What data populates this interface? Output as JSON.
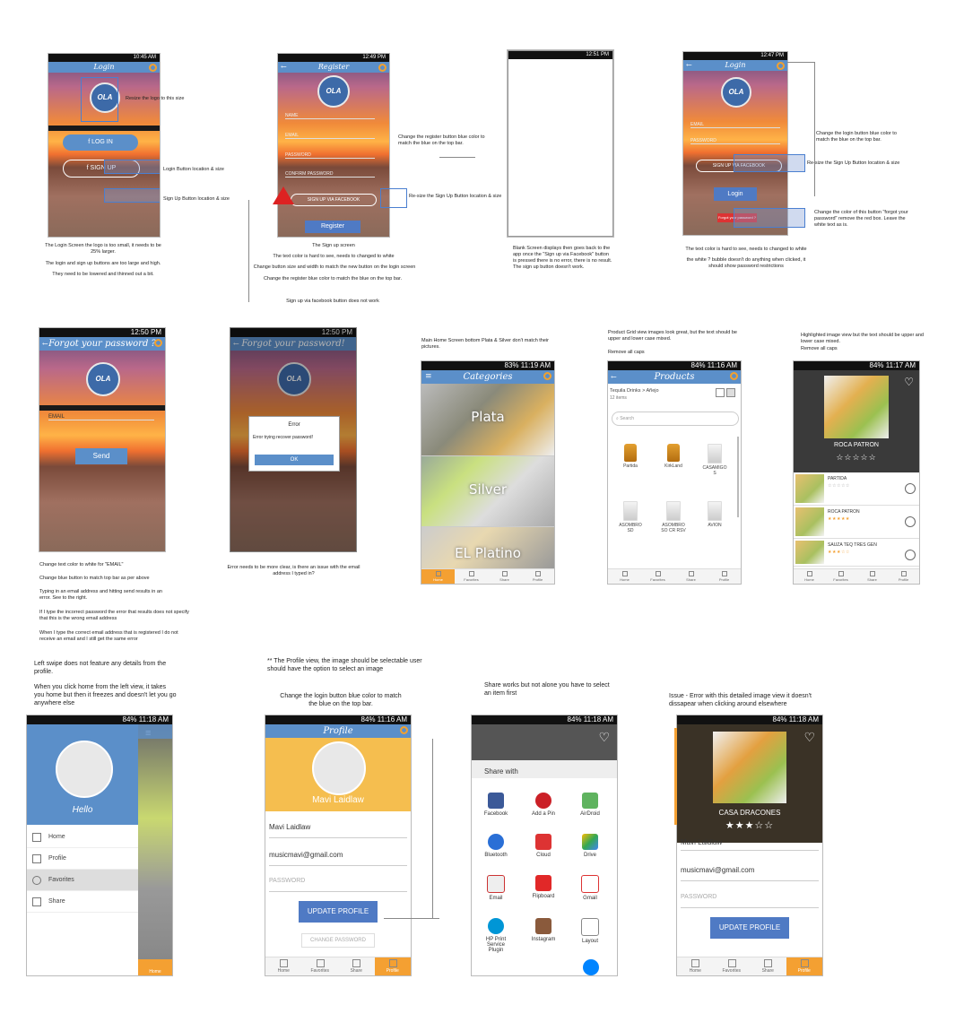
{
  "screens": {
    "login": {
      "status_time": "10:45 AM",
      "title": "Login",
      "logo_text": "OLA",
      "login_button": "LOG IN",
      "signup_button": "SIGN UP",
      "notes": {
        "logo": "Resize the logo to this size",
        "login_loc": "Login Button location & size",
        "signup_loc": "Sign Up Button location & size",
        "bottom": [
          "The Login Screen the logo is too small, it needs to be 25% larger.",
          "The login and sign up buttons are too large and high.",
          "They need to be lowered and thinned out a bit."
        ]
      }
    },
    "register": {
      "status_time": "12:49 PM",
      "title": "Register",
      "fields": [
        "NAME",
        "EMAIL",
        "PASSWORD",
        "CONFIRM PASSWORD"
      ],
      "facebook_button": "SIGN UP VIA FACEBOOK",
      "register_button": "Register",
      "notes": {
        "blue": "Change the register button blue color to match the blue on the top bar.",
        "resize": "Re-size the Sign Up Button location & size",
        "bottom": [
          "The Sign up screen",
          "The text color is hard to see, needs to changed to white",
          "Change button size and width to match the new button on the login screen",
          "Change the register blue color to match the blue on the top bar.",
          "Sign up via facebook button does not work"
        ]
      }
    },
    "blank": {
      "status_time": "12:51 PM",
      "note": "Blank Screen displays then goes back to the app once the \"Sign up via Facebook\" button is pressed there is no error, there is no result. The sign up button doesn't work."
    },
    "login2": {
      "status_time": "12:47 PM",
      "title": "Login",
      "fields": [
        "EMAIL",
        "PASSWORD"
      ],
      "facebook_button": "SIGN UP VIA FACEBOOK",
      "login_button": "Login",
      "forgot": "Forgot your password ?",
      "notes": {
        "blue": "Change the login button blue color to match the blue on the top bar.",
        "resize": "Re-size the Sign Up Button location & size",
        "forgot": "Change the color of this button \"forgot your password\" remove the red box. Leave the white text as is.",
        "bottom": [
          "The text color is hard to see, needs to changed to white",
          "the white ? bubble doesn't do anything when clicked, it should show password restrictions"
        ]
      }
    },
    "forgot": {
      "status_time": "12:50 PM",
      "title": "Forgot your password ?",
      "email": "EMAIL",
      "send": "Send",
      "notes": [
        "Change text color to white for \"EMAIL\"",
        "Change blue button to match top bar as per above",
        "Typing in an email address and hitting send results in an error. See to the right.",
        "If I type the incorrect password the error that results does not specify that this is the wrong email address",
        "When I type the correct email address that is registered I do not receive an email and I still get the same error"
      ]
    },
    "error": {
      "status_time": "12:50 PM",
      "title": "Forgot your password!",
      "dialog_title": "Error",
      "dialog_msg": "Error trying recover password!",
      "ok": "OK",
      "note": "Error needs to be more clear, is there an issue with the email address I typed in?"
    },
    "categories": {
      "status_time": "11:19 AM",
      "battery": "83%",
      "title": "Categories",
      "items": [
        "Plata",
        "Silver",
        "EL Platino"
      ],
      "note": "Main Home Screen bottom Plata & Silver don't match their pictures."
    },
    "products": {
      "status_time": "11:16 AM",
      "battery": "84%",
      "title": "Products",
      "breadcrumb": "Tequila Drinks > Añejo",
      "count": "12 items",
      "search": "Search",
      "items": [
        "Partida",
        "KirkLand",
        "CASAMIGO S",
        "ASOMBRO SD",
        "ASOMBRO SO CR RSV",
        "AVION"
      ],
      "note": [
        "Product Grid view images look great, but the text should be upper and lower case mixed.",
        "Remove all caps"
      ]
    },
    "highlight": {
      "status_time": "11:17 AM",
      "battery": "84%",
      "feature_name": "ROCA PATRON",
      "rows": [
        {
          "name": "PARTIDA",
          "stars": "☆☆☆☆☆"
        },
        {
          "name": "ROCA PATRON",
          "stars": "★★★★★"
        },
        {
          "name": "SAUZA TEQ TRES GEN",
          "stars": "★★★☆☆"
        }
      ],
      "note": [
        "Highlighted image view but the text should be upper and lower case mixed.",
        "Remove all caps"
      ]
    },
    "sidebar": {
      "status_time": "11:18 AM",
      "battery": "84%",
      "hello": "Hello",
      "items": [
        "Home",
        "Profile",
        "Favorites",
        "Share"
      ],
      "note": [
        "Left swipe does not feature any details from the profile.",
        "When you click home from the left view, it takes you home but then it freezes and doesn't let you go anywhere else"
      ]
    },
    "profile": {
      "status_time": "11:16 AM",
      "battery": "84%",
      "title": "Profile",
      "name": "Mavi Laidlaw",
      "name_field": "Mavi Laidlaw",
      "email": "musicmavi@gmail.com",
      "password": "PASSWORD",
      "update": "UPDATE PROFILE",
      "change": "CHANGE PASSWORD",
      "note_top": "** The Profile view, the image should be selectable user should have the option to select an image",
      "note_blue": "Change the login button blue color to match the blue on the top bar."
    },
    "share": {
      "status_time": "11:18 AM",
      "battery": "84%",
      "title": "Share with",
      "items": [
        "Facebook",
        "Add a Pin",
        "AirDroid",
        "Bluetooth",
        "Cloud",
        "Drive",
        "Email",
        "Flipboard",
        "Gmail",
        "HP Print Service Plugin",
        "Instagram",
        "Layout"
      ],
      "note": "Share works but not alone you have to select an item first"
    },
    "detail": {
      "status_time": "11:18 AM",
      "battery": "84%",
      "name": "CASA DRACONES",
      "stars": "★★★☆☆",
      "name_field": "Mavi Laidlaw",
      "email": "musicmavi@gmail.com",
      "password": "PASSWORD",
      "update": "UPDATE PROFILE",
      "note": "Issue - Error with this detailed image view it doesn't dissapear when clicking around elsewhere"
    }
  },
  "nav_labels": [
    "Home",
    "Favorites",
    "Share",
    "Profile"
  ],
  "colors": {
    "topbar": "#5b8fc9",
    "accent": "#f4a032"
  }
}
